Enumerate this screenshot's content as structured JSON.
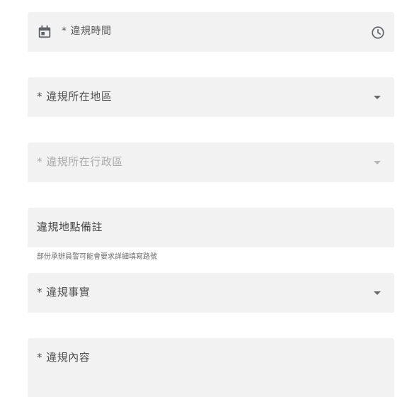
{
  "form": {
    "violation_time": {
      "label": "* 違規時間",
      "leading_icon": "calendar-icon",
      "trailing_icon": "clock-icon"
    },
    "violation_region": {
      "label": "* 違規所在地區",
      "icon": "dropdown-caret-icon"
    },
    "violation_district": {
      "label": "* 違規所在行政區",
      "icon": "dropdown-caret-icon",
      "disabled": true
    },
    "location_note": {
      "label": "違規地點備註",
      "hint": "部份承辦員警可能會要求詳細填寫路號"
    },
    "violation_fact": {
      "label": "* 違規事實",
      "icon": "dropdown-caret-icon"
    },
    "violation_content": {
      "label": "* 違規內容"
    }
  },
  "colors": {
    "field_bg": "#f2f2f2",
    "label": "#505050",
    "label_disabled": "#aaaaaa",
    "icon": "#5f6368",
    "page_bg": "#ffffff"
  }
}
